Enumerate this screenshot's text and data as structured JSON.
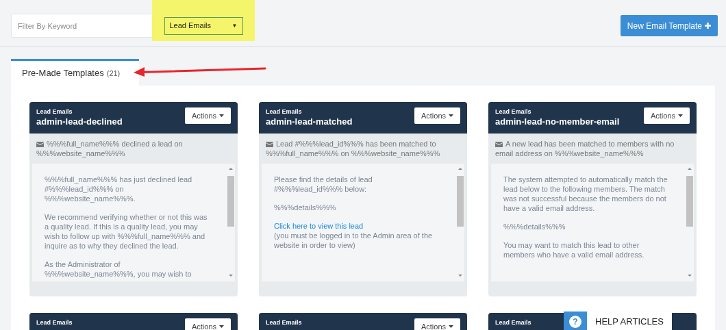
{
  "filter": {
    "placeholder": "Filter By Keyword"
  },
  "category_select": {
    "value": "Lead Emails",
    "caret": "▼",
    "highlighted": true
  },
  "new_button": {
    "label": "New Email Template"
  },
  "tabs": [
    {
      "label": "Pre-Made Templates",
      "count": "(21)",
      "selected": true
    }
  ],
  "annotation_arrow": true,
  "cards": [
    {
      "category": "Lead Emails",
      "name": "admin-lead-declined",
      "actions": "Actions",
      "subject": "%%%full_name%%% declined a lead on %%%website_name%%%",
      "body": [
        [
          {
            "kind": "text",
            "text": "%%%full_name%%% has just declined lead #%%%lead_id%%% on %%%website_name%%%."
          }
        ],
        [
          {
            "kind": "text",
            "text": "We recommend verifying whether or not this was a quality lead. If this is a quality lead, you may wish to follow up with %%%full_name%%% and inquire as to why they declined the lead."
          }
        ],
        [
          {
            "kind": "text",
            "text": "As the Administrator of %%%website_name%%%, you may wish to"
          }
        ]
      ]
    },
    {
      "category": "Lead Emails",
      "name": "admin-lead-matched",
      "actions": "Actions",
      "subject": "Lead #%%%lead_id%%% has been matched to %%%full_name%%% on %%%website_name%%%",
      "body": [
        [
          {
            "kind": "text",
            "text": "Please find the details of lead #%%%lead_id%%% below:"
          }
        ],
        [
          {
            "kind": "text",
            "text": "%%%details%%%"
          }
        ],
        [
          {
            "kind": "link",
            "text": "Click here to view this lead"
          },
          {
            "kind": "text",
            "text": "(you must be logged in to the Admin area of the website in order to view)"
          }
        ]
      ]
    },
    {
      "category": "Lead Emails",
      "name": "admin-lead-no-member-email",
      "actions": "Actions",
      "subject": "A new lead has been matched to members with no email address on %%%website_name%%%",
      "body": [
        [
          {
            "kind": "text",
            "text": "The system attempted to automatically match the lead below to the following members.  The match was not successful because the members do not have a valid email address."
          }
        ],
        [
          {
            "kind": "text",
            "text": "%%%details%%%"
          }
        ],
        [
          {
            "kind": "text",
            "text": "You may want to match this lead to other members who have a valid email address."
          }
        ]
      ]
    },
    {
      "category": "Lead Emails",
      "actions": "Actions"
    },
    {
      "category": "Lead Emails",
      "actions": "Actions"
    },
    {
      "category": "Lead Emails"
    }
  ],
  "help_widget": {
    "icon": "?",
    "label": "HELP ARTICLES"
  }
}
